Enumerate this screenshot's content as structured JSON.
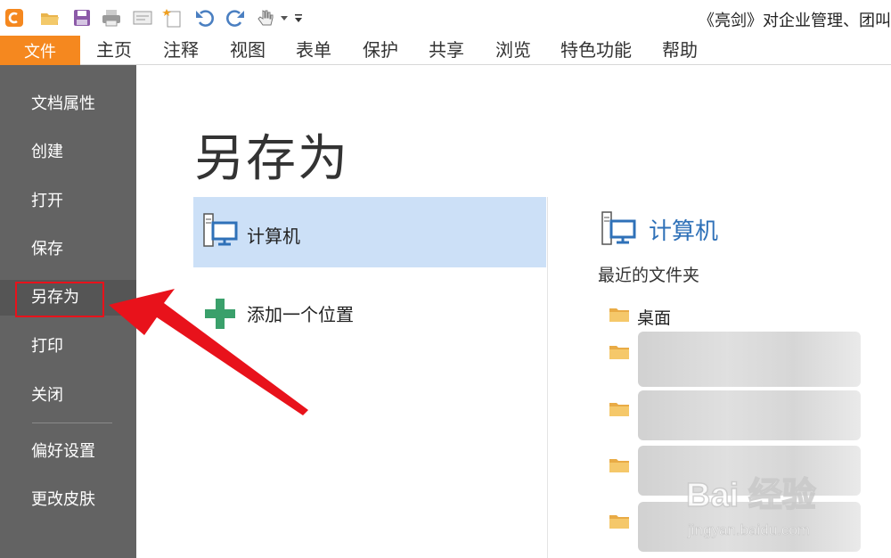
{
  "title_bar": {
    "title": "《亮剑》对企业管理、团叫"
  },
  "quick_access": [
    "app-logo-icon",
    "open-folder-icon",
    "save-icon",
    "print-icon",
    "scan-icon",
    "new-icon",
    "undo-icon",
    "redo-icon",
    "hand-tool-icon",
    "customize-arrow-icon"
  ],
  "menu": {
    "file": "文件",
    "items": [
      "主页",
      "注释",
      "视图",
      "表单",
      "保护",
      "共享",
      "浏览",
      "特色功能",
      "帮助"
    ]
  },
  "sidebar": {
    "items": [
      "文档属性",
      "创建",
      "打开",
      "保存",
      "另存为",
      "打印",
      "关闭",
      "偏好设置",
      "更改皮肤"
    ],
    "active": "另存为"
  },
  "main": {
    "heading": "另存为",
    "locations": {
      "computer": "计算机",
      "add_place": "添加一个位置"
    },
    "right_panel": {
      "title": "计算机",
      "recent_label": "最近的文件夹",
      "folders": [
        "桌面"
      ]
    }
  },
  "watermark": {
    "brand": "Bai 经验",
    "url": "jingyan.baidu.com"
  },
  "colors": {
    "accent_orange": "#f5881f",
    "sidebar": "#636363",
    "selection": "#cce0f7",
    "link_blue": "#2f71b8",
    "highlight_red": "#e8121b",
    "add_green": "#3aa06b"
  }
}
